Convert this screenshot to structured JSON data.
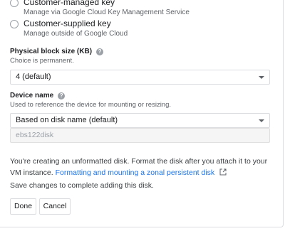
{
  "encryption": {
    "customer_managed": {
      "title": "Customer-managed key",
      "subtitle": "Manage via Google Cloud Key Management Service"
    },
    "customer_supplied": {
      "title": "Customer-supplied key",
      "subtitle": "Manage outside of Google Cloud"
    }
  },
  "block_size": {
    "label": "Physical block size (KB)",
    "hint": "Choice is permanent.",
    "selected": "4 (default)"
  },
  "device_name": {
    "label": "Device name",
    "hint": "Used to reference the device for mounting or resizing.",
    "selected": "Based on disk name (default)",
    "value": "ebs122disk"
  },
  "info": {
    "text": "You're creating an unformatted disk. Format the disk after you attach it to your VM instance.",
    "link": "Formatting and mounting a zonal persistent disk"
  },
  "save_note": "Save changes to complete adding this disk.",
  "buttons": {
    "done": "Done",
    "cancel": "Cancel"
  },
  "help_glyph": "?"
}
